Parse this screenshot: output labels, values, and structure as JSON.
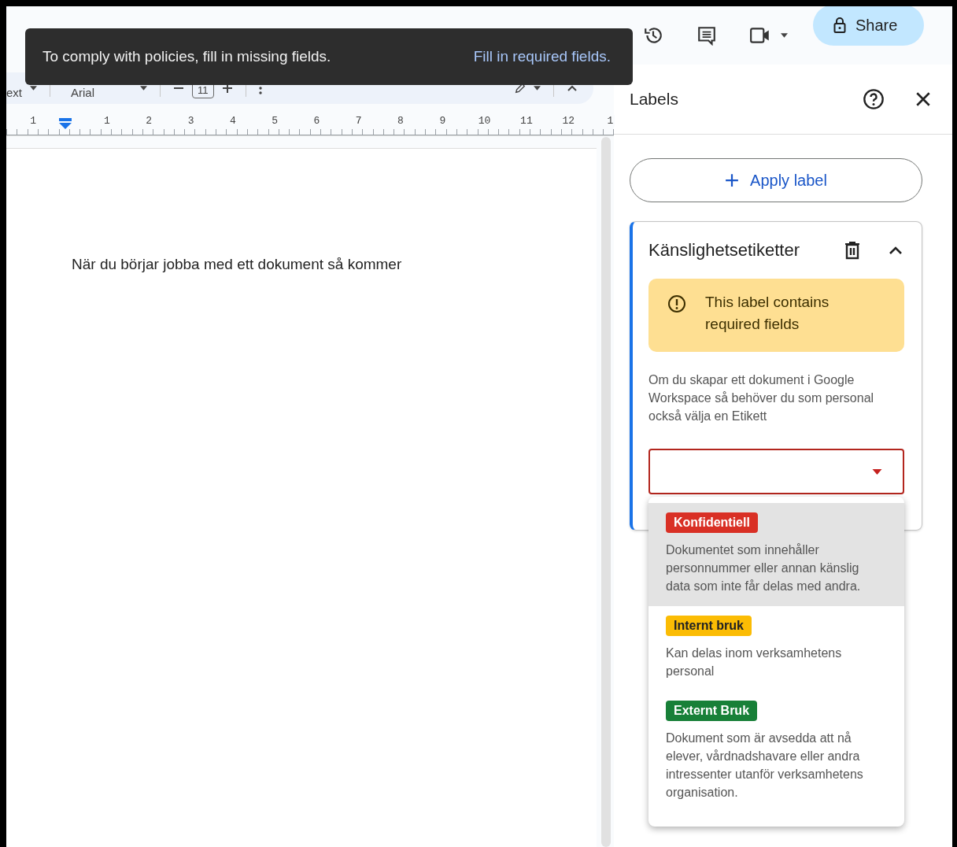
{
  "toast": {
    "message": "To comply with policies, fill in missing fields.",
    "action": "Fill in required fields."
  },
  "toolbar": {
    "style": "ext",
    "font": "Arial",
    "font_size": "11"
  },
  "ruler": {
    "numbers": [
      "1",
      "1",
      "2",
      "3",
      "4",
      "5",
      "6",
      "7",
      "8",
      "9",
      "10",
      "11",
      "12",
      "1"
    ]
  },
  "document": {
    "text": "När du börjar jobba med ett dokument så kommer"
  },
  "header": {
    "share": "Share"
  },
  "panel": {
    "title": "Labels",
    "apply_button": "Apply label",
    "card": {
      "title": "Känslighetsetiketter",
      "expanded": true,
      "warning": "This label contains required fields",
      "description": "Om du skapar ett dokument i Google Workspace så behöver du som personal också välja en Etikett",
      "select": {
        "error": true
      },
      "options": [
        {
          "label": "Konfidentiell",
          "color": "#d93025",
          "description": "Dokumentet som innehåller personnummer eller annan känslig data som inte får delas med andra.",
          "selected": true
        },
        {
          "label": "Internt bruk",
          "color": "#fbbc04",
          "description": "Kan delas inom verksamhetens personal",
          "selected": false
        },
        {
          "label": "Externt Bruk",
          "color": "#188038",
          "description": "Dokument som är avsedda att nå elever, vårdnadshavare eller andra intressenter utanför verksamhetens organisation.",
          "selected": false
        }
      ]
    }
  }
}
